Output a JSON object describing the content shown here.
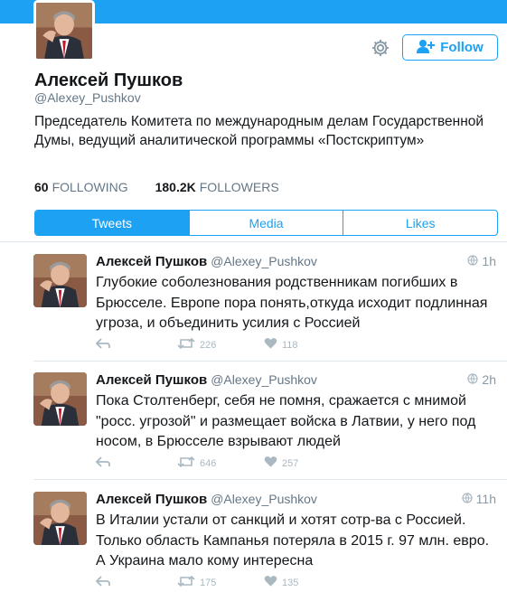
{
  "profile": {
    "name": "Алексей Пушков",
    "handle": "@Alexey_Pushkov",
    "bio": "Председатель Комитета по международным делам Государственной Думы, ведущий аналитической программы «Постскриптум»",
    "following_count": "60",
    "following_label": "FOLLOWING",
    "followers_count": "180.2K",
    "followers_label": "FOLLOWERS",
    "follow_label": "Follow"
  },
  "tabs": [
    {
      "label": "Tweets",
      "active": true
    },
    {
      "label": "Media",
      "active": false
    },
    {
      "label": "Likes",
      "active": false
    }
  ],
  "tweets": [
    {
      "name": "Алексей Пушков",
      "handle": "@Alexey_Pushkov",
      "time": "1h",
      "text": "Глубокие соболезнования родственникам погибших в Брюсселе. Европе пора понять,откуда исходит подлинная угроза, и объединить усилия с Россией",
      "retweets": "226",
      "likes": "118"
    },
    {
      "name": "Алексей Пушков",
      "handle": "@Alexey_Pushkov",
      "time": "2h",
      "text": "Пока Столтенберг, себя не помня, сражается с мнимой \"росс. угрозой\" и размещает войска в Латвии, у него под носом, в Брюсселе взрывают людей",
      "retweets": "646",
      "likes": "257"
    },
    {
      "name": "Алексей Пушков",
      "handle": "@Alexey_Pushkov",
      "time": "11h",
      "text": "В Италии устали от санкций и хотят сотр-ва с Россией. Только область Кампанья потеряла в 2015 г. 97 млн. евро. А Украина мало кому интересна",
      "retweets": "175",
      "likes": "135"
    }
  ],
  "colors": {
    "accent": "#1da1f2",
    "text": "#14171a",
    "muted": "#657786",
    "divider": "#e1e8ed"
  },
  "icons": [
    "settings-gear-icon",
    "follow-user-icon",
    "globe-icon",
    "reply-icon",
    "retweet-icon",
    "like-heart-icon"
  ]
}
